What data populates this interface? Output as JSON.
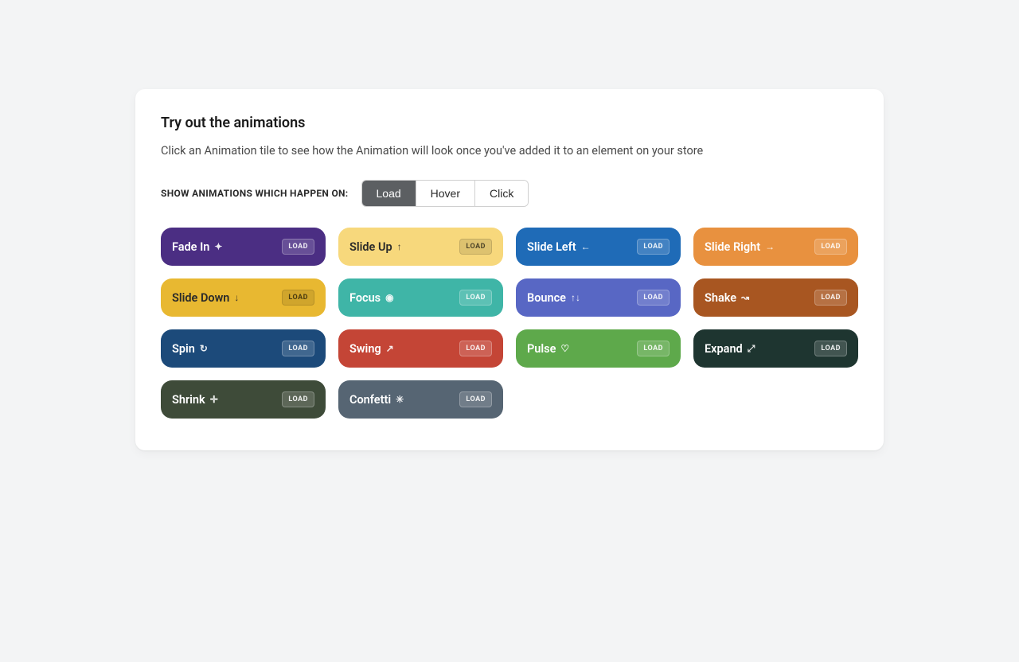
{
  "header": {
    "title": "Try out the animations",
    "description": "Click an Animation tile to see how the Animation will look once you've added it to an element on your store"
  },
  "filter": {
    "label": "SHOW ANIMATIONS WHICH HAPPEN ON:",
    "options": [
      "Load",
      "Hover",
      "Click"
    ],
    "active": "Load"
  },
  "badge_label": "LOAD",
  "tiles": [
    {
      "name": "Fade In",
      "icon": "✦",
      "bg": "#4b2e83",
      "text": "light"
    },
    {
      "name": "Slide Up",
      "icon": "↑",
      "bg": "#f7d87c",
      "text": "dark"
    },
    {
      "name": "Slide Left",
      "icon": "←",
      "bg": "#1f6bb7",
      "text": "light"
    },
    {
      "name": "Slide Right",
      "icon": "→",
      "bg": "#e8913f",
      "text": "light"
    },
    {
      "name": "Slide Down",
      "icon": "↓",
      "bg": "#e8b831",
      "text": "dark"
    },
    {
      "name": "Focus",
      "icon": "◉",
      "bg": "#3fb5a7",
      "text": "light"
    },
    {
      "name": "Bounce",
      "icon": "↑↓",
      "bg": "#5867c4",
      "text": "light"
    },
    {
      "name": "Shake",
      "icon": "↝",
      "bg": "#a85621",
      "text": "light"
    },
    {
      "name": "Spin",
      "icon": "↻",
      "bg": "#1c4a7a",
      "text": "light"
    },
    {
      "name": "Swing",
      "icon": "↗",
      "bg": "#c44536",
      "text": "light"
    },
    {
      "name": "Pulse",
      "icon": "♡",
      "bg": "#5ea94b",
      "text": "light"
    },
    {
      "name": "Expand",
      "icon": "⤢",
      "bg": "#1e3530",
      "text": "light"
    },
    {
      "name": "Shrink",
      "icon": "✛",
      "bg": "#3e4b39",
      "text": "light"
    },
    {
      "name": "Confetti",
      "icon": "✳",
      "bg": "#566573",
      "text": "light"
    }
  ]
}
